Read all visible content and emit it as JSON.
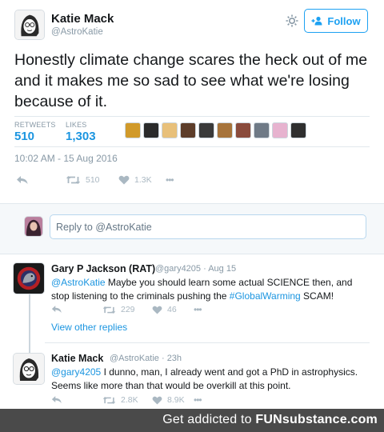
{
  "tweet": {
    "author_name": "Katie Mack",
    "author_handle": "@AstroKatie",
    "follow_label": "Follow",
    "text": "Honestly climate change scares the heck out of me and it makes me so sad to see what we're losing because of it.",
    "retweets_label": "RETWEETS",
    "retweets_value": "510",
    "likes_label": "LIKES",
    "likes_value": "1,303",
    "timestamp": "10:02 AM - 15 Aug 2016",
    "actions": {
      "retweet_count": "510",
      "like_count": "1.3K",
      "more": "•••"
    },
    "liker_colors": [
      "#d19a2a",
      "#2b2b2b",
      "#e8c07a",
      "#5d3d2a",
      "#3a3a3a",
      "#a7743b",
      "#8a4b3c",
      "#6f7a86",
      "#e7b3cf",
      "#2f2f2f"
    ]
  },
  "reply_box": {
    "placeholder": "Reply to @AstroKatie"
  },
  "replies": [
    {
      "name": "Gary P Jackson (RAT)",
      "meta": "@gary4205 · Aug 15",
      "mention": "@AstroKatie",
      "text_part1": " Maybe you should learn some actual SCIENCE then, and stop listening to the criminals pushing the ",
      "hashtag": "#GlobalWarming",
      "text_part2": " SCAM!",
      "retweet_count": "229",
      "like_count": "46",
      "more": "•••"
    },
    {
      "name": "Katie Mack",
      "meta": "@AstroKatie · 23h",
      "mention": "@gary4205",
      "text_part1": " I dunno, man, I already went and got a PhD in astrophysics. Seems like more than that would be overkill at this point.",
      "retweet_count": "2.8K",
      "like_count": "8.9K",
      "more": "•••"
    }
  ],
  "view_other_replies": "View other replies",
  "footer": {
    "prefix": "Get addicted to ",
    "brand": "FUNsubstance.com"
  },
  "colors": {
    "accent": "#1da1f2",
    "link": "#1b95e0",
    "muted": "#8899a6",
    "footer_bg": "#4a4a4a"
  }
}
